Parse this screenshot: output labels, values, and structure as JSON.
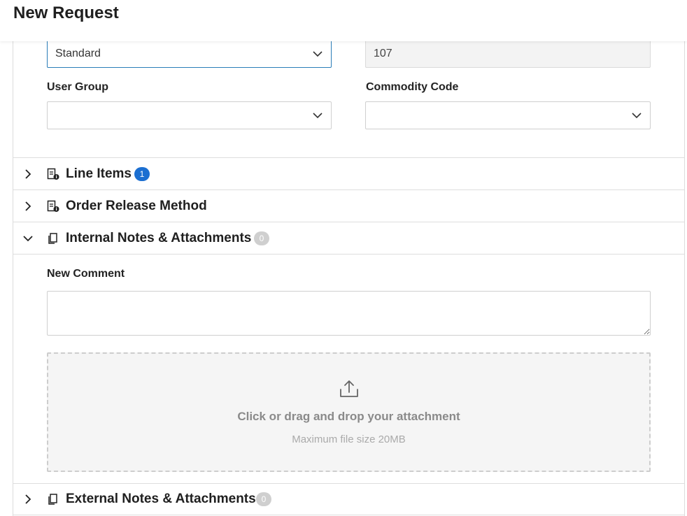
{
  "page": {
    "title": "New Request"
  },
  "form": {
    "type_select": {
      "value": "Standard"
    },
    "number_field": {
      "value": "107"
    },
    "user_group": {
      "label": "User Group",
      "value": ""
    },
    "commodity_code": {
      "label": "Commodity Code",
      "value": ""
    }
  },
  "sections": {
    "line_items": {
      "title": "Line Items",
      "badge": "1",
      "expanded": false
    },
    "order_release": {
      "title": "Order Release Method",
      "expanded": false
    },
    "internal_notes": {
      "title": "Internal Notes & Attachments",
      "badge": "0",
      "expanded": true
    },
    "external_notes": {
      "title": "External Notes & Attachments",
      "badge": "0",
      "expanded": false
    }
  },
  "comment": {
    "label": "New Comment",
    "value": ""
  },
  "dropzone": {
    "main_text": "Click or drag and drop your attachment",
    "sub_text": "Maximum file size 20MB"
  },
  "colors": {
    "accent": "#1c6fd1",
    "focus_border": "#2a7db8",
    "badge_grey": "#cfcfcf"
  },
  "icons": {
    "expand": "chevron-right-icon",
    "collapse": "chevron-down-icon",
    "document": "document-info-icon",
    "notes": "copy-icon",
    "upload": "upload-icon"
  }
}
